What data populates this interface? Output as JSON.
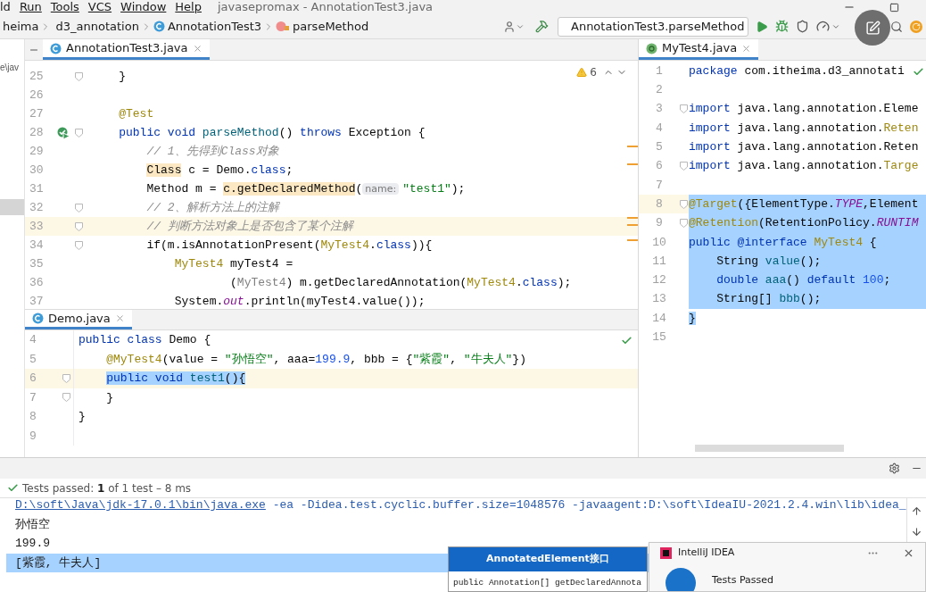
{
  "menu": [
    "ld",
    "Run",
    "Tools",
    "VCS",
    "Window",
    "Help"
  ],
  "window": {
    "title": "javasepromax - AnnotationTest3.java"
  },
  "breadcrumbs": [
    {
      "label": "heima",
      "kind": "folder"
    },
    {
      "label": "d3_annotation",
      "kind": "folder"
    },
    {
      "label": "AnnotationTest3",
      "kind": "class"
    },
    {
      "label": "parseMethod",
      "kind": "method"
    }
  ],
  "run_config": "AnnotationTest3.parseMethod",
  "project_path": "e\\jav",
  "left_editor": {
    "tab": {
      "label": "AnnotationTest3.java",
      "selected": true
    },
    "warnings": "6",
    "lines": [
      {
        "number": "25",
        "fold": true,
        "current": false,
        "tokens": [
          {
            "text": "    }",
            "kind": "plain"
          }
        ]
      },
      {
        "number": "26",
        "fold": false,
        "current": false
      },
      {
        "number": "27",
        "fold": false,
        "current": false,
        "tokens": [
          {
            "text": "    @Test",
            "kind": "ann"
          }
        ]
      },
      {
        "number": "28",
        "fold": true,
        "current": false,
        "run_icon": true,
        "tokens": [
          {
            "text": "    public void ",
            "kind": "kw"
          },
          {
            "text": "parseMethod",
            "kind": "fn"
          },
          {
            "text": "() ",
            "kind": "plain"
          },
          {
            "text": "throws ",
            "kind": "kw"
          },
          {
            "text": "Exception {",
            "kind": "plain"
          }
        ]
      },
      {
        "number": "29",
        "fold": false,
        "current": false,
        "tokens": [
          {
            "text": "        // 1、先得到Class对象",
            "kind": "cmt"
          }
        ]
      },
      {
        "number": "30",
        "fold": false,
        "current": false,
        "tokens": [
          {
            "text": "        Class",
            "kind": "plain",
            "mark": true
          },
          {
            "text": " c = Demo.",
            "kind": "plain"
          },
          {
            "text": "class",
            "kind": "kw"
          },
          {
            "text": ";",
            "kind": "plain"
          }
        ]
      },
      {
        "number": "31",
        "fold": false,
        "current": false,
        "tokens": [
          {
            "text": "        Method m = ",
            "kind": "plain"
          },
          {
            "text": "c.getDeclaredMethod",
            "kind": "plain",
            "mark": true
          },
          {
            "text": "(",
            "kind": "plain"
          },
          {
            "text": "name:",
            "kind": "hint"
          },
          {
            "text": "\"test1\"",
            "kind": "str"
          },
          {
            "text": ");",
            "kind": "plain"
          }
        ]
      },
      {
        "number": "32",
        "fold": true,
        "current": false,
        "tokens": [
          {
            "text": "        // 2、解析方法上的注解",
            "kind": "cmt"
          }
        ]
      },
      {
        "number": "33",
        "fold": true,
        "current": true,
        "tokens": [
          {
            "text": "        // 判断方法对象上是否包含了某个注解",
            "kind": "cmt"
          }
        ]
      },
      {
        "number": "34",
        "fold": true,
        "current": false,
        "tokens": [
          {
            "text": "        if(m.isAnnotationPresent(",
            "kind": "plain"
          },
          {
            "text": "MyTest4",
            "kind": "ann"
          },
          {
            "text": ".",
            "kind": "plain"
          },
          {
            "text": "class",
            "kind": "kw"
          },
          {
            "text": ")){",
            "kind": "plain"
          }
        ]
      },
      {
        "number": "35",
        "fold": false,
        "current": false,
        "tokens": [
          {
            "text": "            MyTest4",
            "kind": "ann"
          },
          {
            "text": " myTest4 =",
            "kind": "plain"
          }
        ]
      },
      {
        "number": "36",
        "fold": false,
        "current": false,
        "tokens": [
          {
            "text": "                    (",
            "kind": "plain"
          },
          {
            "text": "MyTest4",
            "kind": "dim"
          },
          {
            "text": ") m.getDeclaredAnnotation(",
            "kind": "plain"
          },
          {
            "text": "MyTest4",
            "kind": "ann"
          },
          {
            "text": ".",
            "kind": "plain"
          },
          {
            "text": "class",
            "kind": "kw"
          },
          {
            "text": ");",
            "kind": "plain"
          }
        ]
      },
      {
        "number": "37",
        "fold": false,
        "current": false,
        "tokens": [
          {
            "text": "            System.",
            "kind": "plain"
          },
          {
            "text": "out",
            "kind": "fld"
          },
          {
            "text": ".println(myTest4.value());",
            "kind": "plain"
          }
        ]
      }
    ]
  },
  "demo_editor": {
    "tab": {
      "label": "Demo.java",
      "selected": true
    },
    "inspection_ok": true,
    "lines": [
      {
        "number": "4",
        "fold": false,
        "current": false,
        "tokens": [
          {
            "text": "public class ",
            "kind": "kw"
          },
          {
            "text": "Demo {",
            "kind": "plain"
          }
        ]
      },
      {
        "number": "5",
        "fold": false,
        "current": false,
        "tokens": [
          {
            "text": "    @MyTest4",
            "kind": "ann"
          },
          {
            "text": "(value = ",
            "kind": "plain"
          },
          {
            "text": "\"孙悟空\"",
            "kind": "str"
          },
          {
            "text": ", aaa=",
            "kind": "plain"
          },
          {
            "text": "199.9",
            "kind": "num"
          },
          {
            "text": ", bbb = {",
            "kind": "plain"
          },
          {
            "text": "\"紫霞\"",
            "kind": "str"
          },
          {
            "text": ", ",
            "kind": "plain"
          },
          {
            "text": "\"牛夫人\"",
            "kind": "str"
          },
          {
            "text": "})",
            "kind": "plain"
          }
        ]
      },
      {
        "number": "6",
        "fold": true,
        "current": true,
        "tokens": [
          {
            "text": "    public void ",
            "kind": "kw",
            "sel": true
          },
          {
            "text": "test1",
            "kind": "fn",
            "sel": true
          },
          {
            "text": "(){",
            "kind": "plain",
            "sel": true
          }
        ]
      },
      {
        "number": "7",
        "fold": true,
        "current": false,
        "tokens": [
          {
            "text": "    }",
            "kind": "plain"
          }
        ]
      },
      {
        "number": "8",
        "fold": false,
        "current": false,
        "tokens": [
          {
            "text": "}",
            "kind": "plain"
          }
        ]
      },
      {
        "number": "9",
        "fold": false,
        "current": false
      }
    ]
  },
  "right_editor": {
    "tab": {
      "label": "MyTest4.java",
      "selected": true
    },
    "inspection_ok": true,
    "lines": [
      {
        "number": "1",
        "fold": false,
        "current": false,
        "selected": false,
        "tokens": [
          {
            "text": "package ",
            "kind": "kw"
          },
          {
            "text": "com.itheima.d3_annotati",
            "kind": "plain"
          }
        ]
      },
      {
        "number": "2",
        "fold": false,
        "current": false,
        "selected": false
      },
      {
        "number": "3",
        "fold": true,
        "current": false,
        "selected": false,
        "tokens": [
          {
            "text": "import ",
            "kind": "kw"
          },
          {
            "text": "java.lang.annotation.Eleme",
            "kind": "plain"
          }
        ]
      },
      {
        "number": "4",
        "fold": false,
        "current": false,
        "selected": false,
        "tokens": [
          {
            "text": "import ",
            "kind": "kw"
          },
          {
            "text": "java.lang.annotation.",
            "kind": "plain"
          },
          {
            "text": "Reten",
            "kind": "ann"
          }
        ]
      },
      {
        "number": "5",
        "fold": false,
        "current": false,
        "selected": false,
        "tokens": [
          {
            "text": "import ",
            "kind": "kw"
          },
          {
            "text": "java.lang.annotation.Reten",
            "kind": "plain"
          }
        ]
      },
      {
        "number": "6",
        "fold": true,
        "current": false,
        "selected": false,
        "tokens": [
          {
            "text": "import ",
            "kind": "kw"
          },
          {
            "text": "java.lang.annotation.",
            "kind": "plain"
          },
          {
            "text": "Targe",
            "kind": "ann"
          }
        ]
      },
      {
        "number": "7",
        "fold": false,
        "current": false,
        "selected": false
      },
      {
        "number": "8",
        "fold": true,
        "current": true,
        "selected": true,
        "tokens": [
          {
            "text": "@Target",
            "kind": "ann"
          },
          {
            "text": "({ElementType.",
            "kind": "plain"
          },
          {
            "text": "TYPE",
            "kind": "fld"
          },
          {
            "text": ",Element",
            "kind": "plain"
          }
        ]
      },
      {
        "number": "9",
        "fold": true,
        "current": false,
        "selected": true,
        "tokens": [
          {
            "text": "@Retention",
            "kind": "ann"
          },
          {
            "text": "(RetentionPolicy.",
            "kind": "plain"
          },
          {
            "text": "RUNTIM",
            "kind": "fld"
          }
        ]
      },
      {
        "number": "10",
        "fold": false,
        "current": false,
        "selected": true,
        "tokens": [
          {
            "text": "public @interface ",
            "kind": "kw"
          },
          {
            "text": "MyTest4",
            "kind": "ann"
          },
          {
            "text": " {",
            "kind": "plain"
          }
        ]
      },
      {
        "number": "11",
        "fold": false,
        "current": false,
        "selected": true,
        "tokens": [
          {
            "text": "    String ",
            "kind": "plain"
          },
          {
            "text": "value",
            "kind": "fn"
          },
          {
            "text": "();",
            "kind": "plain"
          }
        ]
      },
      {
        "number": "12",
        "fold": false,
        "current": false,
        "selected": true,
        "tokens": [
          {
            "text": "    double ",
            "kind": "kw"
          },
          {
            "text": "aaa",
            "kind": "fn"
          },
          {
            "text": "() ",
            "kind": "plain"
          },
          {
            "text": "default ",
            "kind": "kw"
          },
          {
            "text": "100",
            "kind": "num"
          },
          {
            "text": ";",
            "kind": "plain"
          }
        ]
      },
      {
        "number": "13",
        "fold": false,
        "current": false,
        "selected": true,
        "tokens": [
          {
            "text": "    String[] ",
            "kind": "plain"
          },
          {
            "text": "bbb",
            "kind": "fn"
          },
          {
            "text": "();",
            "kind": "plain"
          }
        ]
      },
      {
        "number": "14",
        "fold": false,
        "current": false,
        "selected": false,
        "tokens": [
          {
            "text": "}",
            "kind": "plain",
            "sel": true
          }
        ]
      },
      {
        "number": "15",
        "fold": false,
        "current": false,
        "selected": false
      }
    ]
  },
  "test_status": "Tests passed: **1** of 1 test – 8 ms",
  "console": [
    {
      "text": "D:\\soft\\Java\\jdk-17.0.1\\bin\\java.exe",
      "kind": "link",
      "rest": " -ea -Didea.test.cyclic.buffer.size=1048576 -javaagent:D:\\soft\\IdeaIU-2021.2.4.win\\lib\\idea_",
      "selected": false
    },
    {
      "text": "孙悟空",
      "kind": "out",
      "selected": false
    },
    {
      "text": "199.9",
      "kind": "out",
      "selected": false
    },
    {
      "text": "[紫霞, 牛夫人]",
      "kind": "out",
      "selected": true
    }
  ],
  "doc_popup": {
    "title": "AnnotatedElement接口",
    "code": "public Annotation[] getDeclaredAnnota"
  },
  "notification": {
    "app": "IntelliJ IDEA",
    "title": "Tests Passed"
  }
}
